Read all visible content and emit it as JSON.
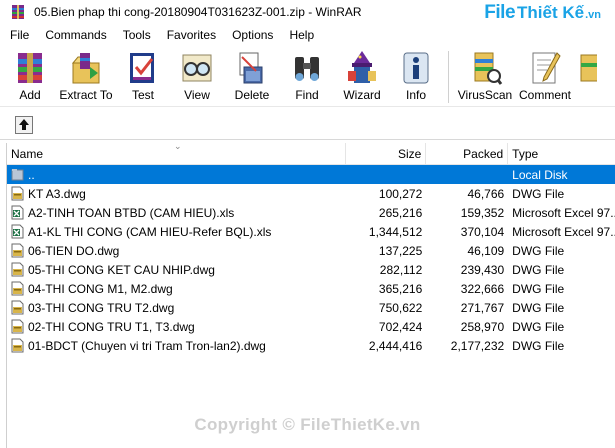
{
  "window": {
    "title": "05.Bien phap thi cong-20180904T031623Z-001.zip - WinRAR"
  },
  "watermark": {
    "brand": "File",
    "brand2": "Thiết Kế",
    "suffix": ".vn",
    "footer": "Copyright © FileThietKe.vn"
  },
  "menu": [
    "File",
    "Commands",
    "Tools",
    "Favorites",
    "Options",
    "Help"
  ],
  "toolbar": [
    {
      "label": "Add",
      "icon": "add-archive-icon"
    },
    {
      "label": "Extract To",
      "icon": "extract-to-icon"
    },
    {
      "label": "Test",
      "icon": "test-icon"
    },
    {
      "label": "View",
      "icon": "view-glasses-icon"
    },
    {
      "label": "Delete",
      "icon": "delete-icon"
    },
    {
      "label": "Find",
      "icon": "find-binoculars-icon"
    },
    {
      "label": "Wizard",
      "icon": "wizard-icon"
    },
    {
      "label": "Info",
      "icon": "info-icon"
    },
    {
      "label": "VirusScan",
      "icon": "virus-scan-icon"
    },
    {
      "label": "Comment",
      "icon": "comment-icon"
    }
  ],
  "columns": {
    "name": "Name",
    "size": "Size",
    "packed": "Packed",
    "type": "Type"
  },
  "files": [
    {
      "name": "..",
      "size": "",
      "packed": "",
      "type": "Local Disk",
      "icon": "parent-folder-icon",
      "selected": true
    },
    {
      "name": "KT A3.dwg",
      "size": "100,272",
      "packed": "46,766",
      "type": "DWG File",
      "icon": "dwg-file-icon"
    },
    {
      "name": "A2-TINH TOAN BTBD (CAM HIEU).xls",
      "size": "265,216",
      "packed": "159,352",
      "type": "Microsoft Excel 97...",
      "icon": "excel-file-icon"
    },
    {
      "name": "A1-KL THI CONG (CAM HIEU-Refer BQL).xls",
      "size": "1,344,512",
      "packed": "370,104",
      "type": "Microsoft Excel 97...",
      "icon": "excel-file-icon"
    },
    {
      "name": "06-TIEN DO.dwg",
      "size": "137,225",
      "packed": "46,109",
      "type": "DWG File",
      "icon": "dwg-file-icon"
    },
    {
      "name": "05-THI CONG KET CAU NHIP.dwg",
      "size": "282,112",
      "packed": "239,430",
      "type": "DWG File",
      "icon": "dwg-file-icon"
    },
    {
      "name": "04-THI CONG M1, M2.dwg",
      "size": "365,216",
      "packed": "322,666",
      "type": "DWG File",
      "icon": "dwg-file-icon"
    },
    {
      "name": "03-THI CONG TRU T2.dwg",
      "size": "750,622",
      "packed": "271,767",
      "type": "DWG File",
      "icon": "dwg-file-icon"
    },
    {
      "name": "02-THI CONG TRU T1, T3.dwg",
      "size": "702,424",
      "packed": "258,970",
      "type": "DWG File",
      "icon": "dwg-file-icon"
    },
    {
      "name": "01-BDCT (Chuyen vi tri Tram Tron-lan2).dwg",
      "size": "2,444,416",
      "packed": "2,177,232",
      "type": "DWG File",
      "icon": "dwg-file-icon"
    }
  ],
  "colors": {
    "selection": "#0078d7",
    "watermark": "#1aa3e6"
  }
}
